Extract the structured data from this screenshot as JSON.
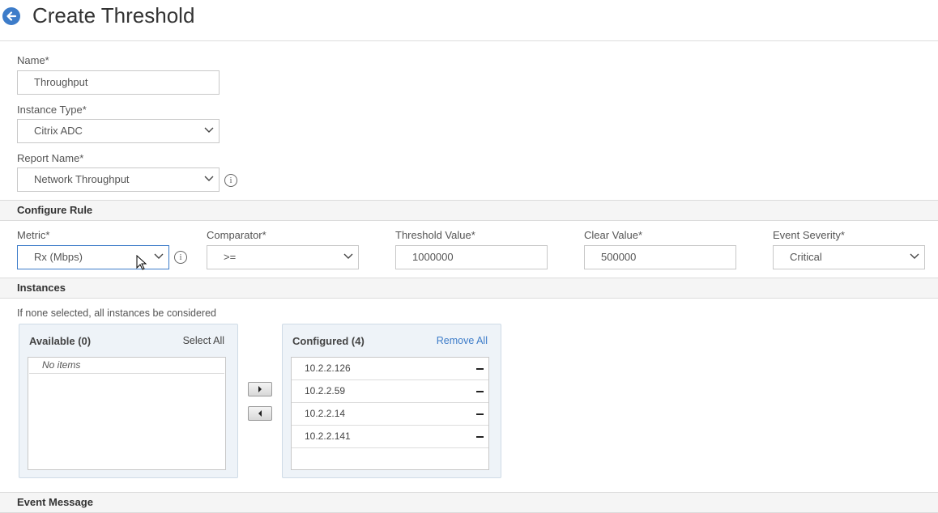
{
  "header": {
    "title": "Create Threshold"
  },
  "form": {
    "name_label": "Name*",
    "name_value": "Throughput",
    "instance_type_label": "Instance Type*",
    "instance_type_value": "Citrix ADC",
    "report_name_label": "Report Name*",
    "report_name_value": "Network Throughput"
  },
  "configure_rule": {
    "title": "Configure Rule",
    "metric_label": "Metric*",
    "metric_value": "Rx (Mbps)",
    "comparator_label": "Comparator*",
    "comparator_value": ">=",
    "threshold_label": "Threshold Value*",
    "threshold_value": "1000000",
    "clear_label": "Clear Value*",
    "clear_value": "500000",
    "severity_label": "Event Severity*",
    "severity_value": "Critical"
  },
  "instances": {
    "title": "Instances",
    "hint": "If none selected, all instances be considered",
    "available_title": "Available (0)",
    "select_all": "Select All",
    "no_items": "No items",
    "configured_title": "Configured (4)",
    "remove_all": "Remove All",
    "configured_items": [
      "10.2.2.126",
      "10.2.2.59",
      "10.2.2.14",
      "10.2.2.141"
    ]
  },
  "event_message": {
    "title": "Event Message"
  },
  "colors": {
    "accent": "#3d7cc9"
  }
}
